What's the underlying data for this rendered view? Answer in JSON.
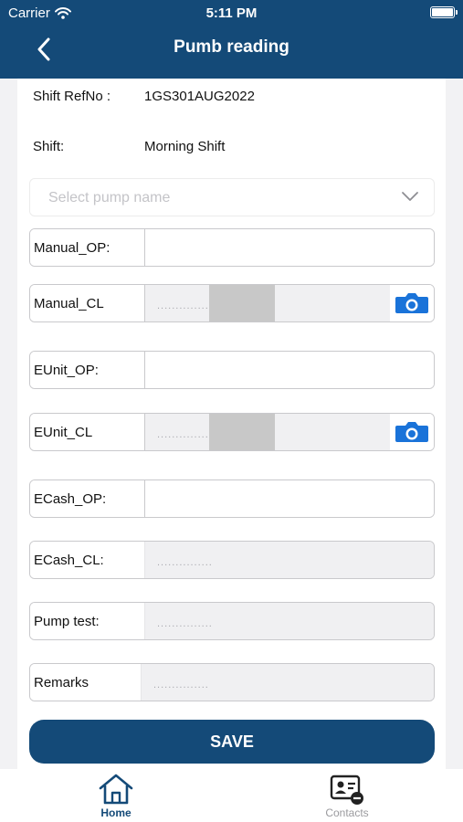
{
  "status_bar": {
    "carrier": "Carrier",
    "time": "5:11 PM"
  },
  "header": {
    "title": "Pumb reading"
  },
  "info": {
    "shift_refno_label": "Shift RefNo :",
    "shift_refno_value": "1GS301AUG2022",
    "shift_label": "Shift:",
    "shift_value": "Morning Shift"
  },
  "pump_select": {
    "placeholder": "Select pump name"
  },
  "fields": {
    "manual_op": {
      "label": "Manual_OP:",
      "value": ""
    },
    "manual_cl": {
      "label": "Manual_CL",
      "value": "..............."
    },
    "eunit_op": {
      "label": "EUnit_OP:",
      "value": ""
    },
    "eunit_cl": {
      "label": "EUnit_CL",
      "value": "..............."
    },
    "ecash_op": {
      "label": "ECash_OP:",
      "value": ""
    },
    "ecash_cl": {
      "label": "ECash_CL:",
      "value": "..............."
    },
    "pump_test": {
      "label": "Pump test:",
      "value": "..............."
    },
    "remarks": {
      "label": "Remarks",
      "value": "..............."
    }
  },
  "save_label": "SAVE",
  "tabs": {
    "home": {
      "label": "Home",
      "icon": "home-icon"
    },
    "contacts": {
      "label": "Contacts",
      "icon": "contact-card-icon"
    }
  },
  "colors": {
    "primary": "#144a78",
    "camera": "#1a73d9"
  }
}
